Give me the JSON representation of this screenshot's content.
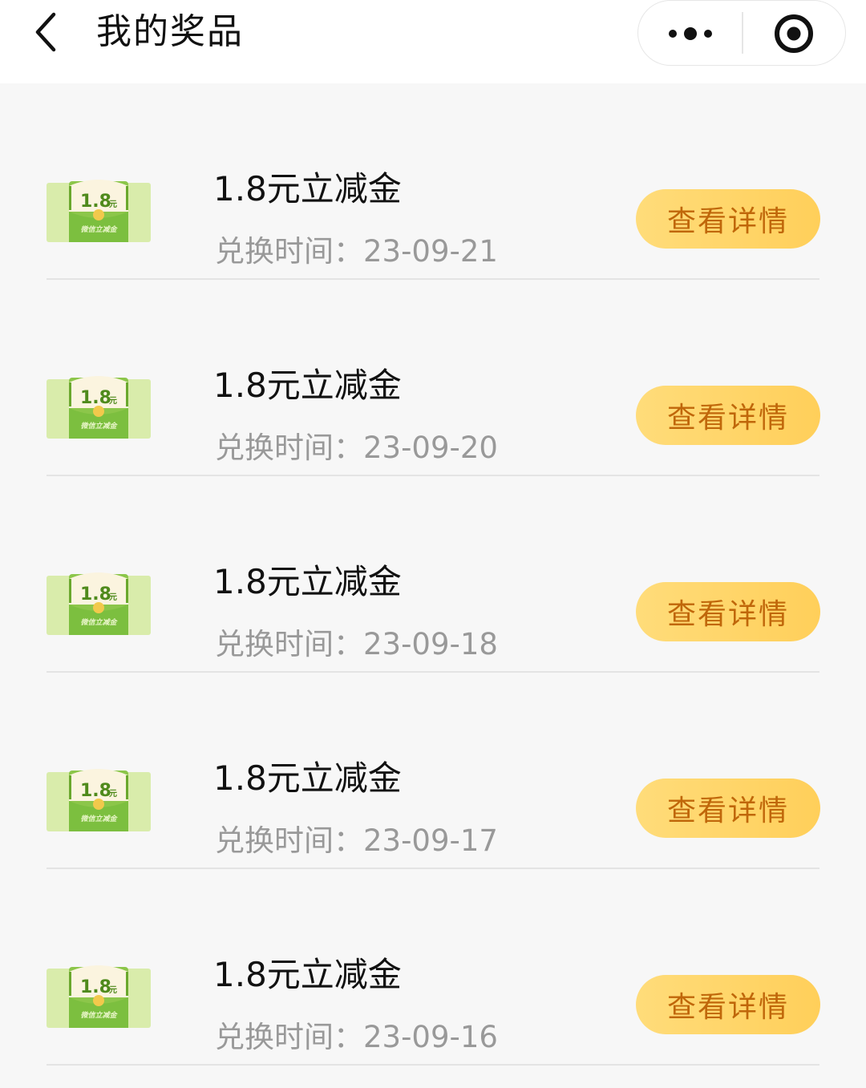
{
  "nav": {
    "title": "我的奖品",
    "back_icon": "chevron-left-icon",
    "more_icon": "more-dots-icon",
    "close_icon": "target-close-icon"
  },
  "colors": {
    "accent_button_start": "#ffdc7a",
    "accent_button_end": "#ffcf5a",
    "button_text": "#c0670a",
    "secondary_text": "#999999",
    "thumb_green": "#7cbf3f"
  },
  "thumb": {
    "amount": "1.8",
    "unit": "元",
    "caption": "微信立减金"
  },
  "prizes": [
    {
      "name": "1.8元立减金",
      "exchange_label": "兑换时间：",
      "date": "23-09-21",
      "button": "查看详情"
    },
    {
      "name": "1.8元立减金",
      "exchange_label": "兑换时间：",
      "date": "23-09-20",
      "button": "查看详情"
    },
    {
      "name": "1.8元立减金",
      "exchange_label": "兑换时间：",
      "date": "23-09-18",
      "button": "查看详情"
    },
    {
      "name": "1.8元立减金",
      "exchange_label": "兑换时间：",
      "date": "23-09-17",
      "button": "查看详情"
    },
    {
      "name": "1.8元立减金",
      "exchange_label": "兑换时间：",
      "date": "23-09-16",
      "button": "查看详情"
    }
  ]
}
